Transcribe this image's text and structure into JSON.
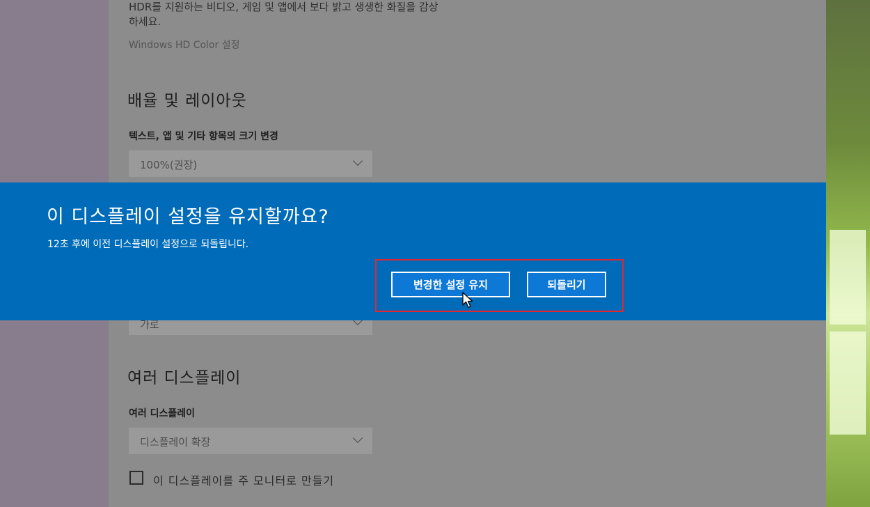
{
  "settings": {
    "hdr_desc_line1": "HDR를 지원하는 비디오, 게임 및 앱에서 보다 밝고 생생한 화질을 감상",
    "hdr_desc_line2": "하세요.",
    "hdr_link": "Windows HD Color 설정",
    "scale_heading": "배율 및 레이아웃",
    "scale_label": "텍스트, 앱 및 기타 항목의 크기 변경",
    "scale_value": "100%(권장)",
    "orientation_value": "가로",
    "multi_heading": "여러 디스플레이",
    "multi_label": "여러 디스플레이",
    "multi_value": "디스플레이 확장",
    "main_monitor_label": "이 디스플레이를 주 모니터로 만들기",
    "main_monitor_checked": false
  },
  "dialog": {
    "title": "이 디스플레이 설정을 유지할까요?",
    "subtitle": "12초 후에 이전 디스플레이 설정으로 되돌립니다.",
    "keep_button": "변경한 설정 유지",
    "revert_button": "되돌리기"
  },
  "colors": {
    "dialog_bg": "#006bb8",
    "button_bg": "#0d78d6",
    "highlight_border": "#e3262f"
  }
}
